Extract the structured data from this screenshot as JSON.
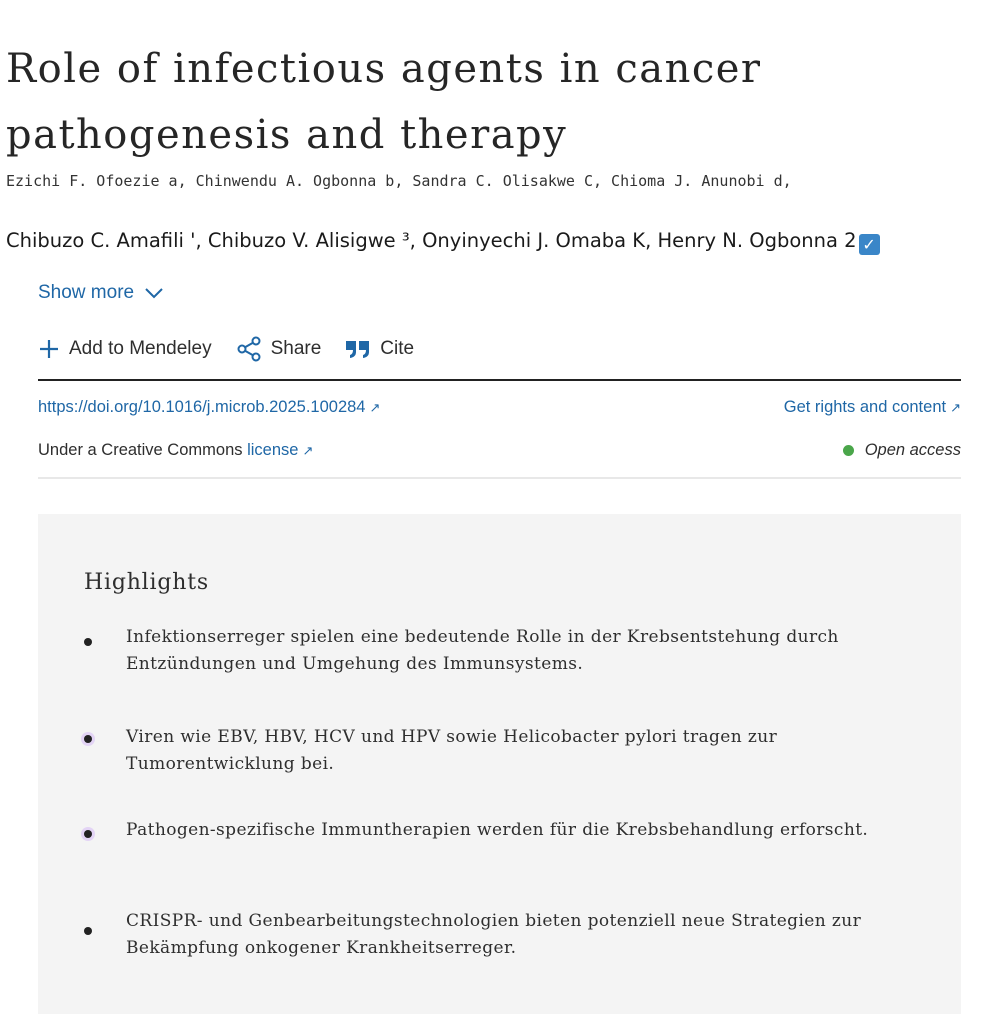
{
  "article": {
    "title": "Role of infectious agents in cancer pathogenesis and therapy",
    "authors_line1": "Ezichi F. Ofoezie a, Chinwendu A. Ogbonna b, Sandra C. Olisakwe C, Chioma J. Anunobi d,",
    "authors_line2": "Chibuzo C. Amafili ', Chibuzo V. Alisigwe ³, Onyinyechi J. Omaba K, Henry N. Ogbonna 2",
    "show_more": "Show more"
  },
  "toolbar": {
    "mendeley": "Add to Mendeley",
    "share": "Share",
    "cite": "Cite"
  },
  "meta": {
    "doi": "https://doi.org/10.1016/j.microb.2025.100284",
    "rights": "Get rights and content",
    "license_prefix": "Under a Creative Commons",
    "license_link": "license",
    "open_access": "Open access"
  },
  "highlights": {
    "title": "Highlights",
    "items": [
      "Infektionserreger spielen eine bedeutende Rolle in der Krebsentstehung durch Entzündungen und Umgehung des Immunsystems.",
      "Viren wie EBV, HBV, HCV und HPV sowie Helicobacter pylori tragen zur Tumorentwicklung bei.",
      "Pathogen-spezifische Immuntherapien werden für die Krebsbehandlung erforscht.",
      "CRISPR- und Genbearbeitungstechnologien bieten potenziell neue Strategien zur Bekämpfung onkogener Krankheitserreger."
    ]
  },
  "colors": {
    "link": "#1f67a6",
    "open_access_dot": "#4aa64a",
    "highlights_bg": "#f4f4f4"
  }
}
